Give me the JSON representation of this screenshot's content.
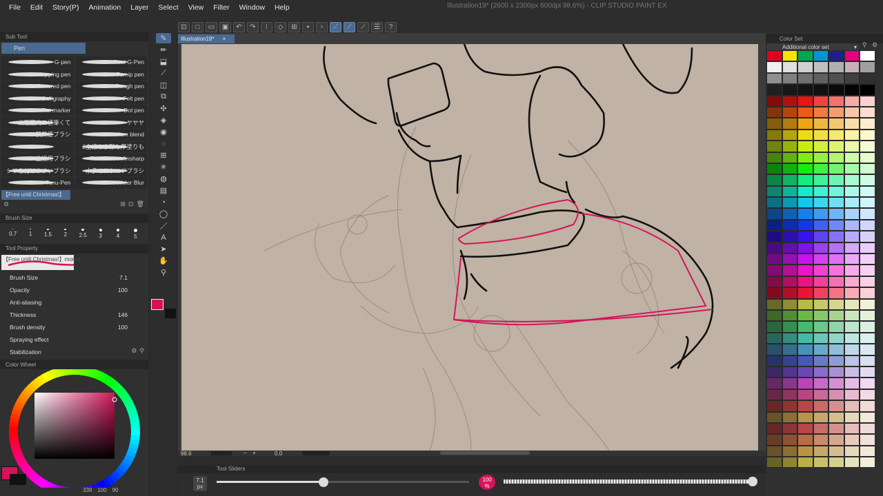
{
  "menu": [
    "File",
    "Edit",
    "Story(P)",
    "Animation",
    "Layer",
    "Select",
    "View",
    "Filter",
    "Window",
    "Help"
  ],
  "window_title": "Illustration19* (2600 x 2300px 600dpi 98.6%) - CLIP STUDIO PAINT EX",
  "subtool": {
    "header": "Sub Tool",
    "group": "Pen",
    "brushes": [
      {
        "left": "G-pen",
        "right": "Real G-Pen"
      },
      {
        "left": "Mapping pen",
        "right": "Turnip pen"
      },
      {
        "left": "Textured pen",
        "right": "Rough pen"
      },
      {
        "left": "Calligraphy",
        "right": "Felt pen"
      },
      {
        "left": "Flat marker",
        "right": "Dot pen"
      },
      {
        "left": "山猫筋肉二値筆くて",
        "right": "ヤヤヤ"
      },
      {
        "left": "肌質感ブラシ",
        "right": "Medium blend"
      },
      {
        "left": "",
        "right": "2主線も水彩も厚塗りも"
      },
      {
        "left": "主線用ブラシ",
        "right": "Tanu-Pen softnsharp"
      },
      {
        "left": "シワを付けやすいブラシ",
        "right": "水多めスケエアブラシ"
      },
      {
        "left": "Tanu-Pen",
        "right": "Water Blur"
      }
    ],
    "selected": "【Free until Christmas!】"
  },
  "brush_size_panel": {
    "header": "Brush Size",
    "sizes": [
      "0.7",
      "1",
      "1.5",
      "2",
      "2.5",
      "3",
      "4",
      "5"
    ]
  },
  "tool_property": {
    "header": "Tool Property",
    "preset": "【Free until Christmas!】morna",
    "rows": [
      {
        "label": "Brush Size",
        "value": "7.1"
      },
      {
        "label": "Opacity",
        "value": "100"
      },
      {
        "label": "Anti-aliasing",
        "value": ""
      },
      {
        "label": "Thickness",
        "value": "146"
      },
      {
        "label": "Brush density",
        "value": "100"
      },
      {
        "label": "Spraying effect",
        "value": ""
      },
      {
        "label": "Stabilization",
        "value": ""
      }
    ]
  },
  "color_wheel": {
    "header": "Color Wheel",
    "main_color": "#d4145a",
    "values": [
      "339",
      "100",
      "90"
    ]
  },
  "document_tab": "Illustration19*",
  "navigator": {
    "zoom": "98.6",
    "angle": "0.0"
  },
  "tool_sliders": {
    "header": "Tool Sliders",
    "size_value": "7.1",
    "size_unit": "px",
    "opacity_value": "100",
    "opacity_unit": "%"
  },
  "color_set": {
    "header": "Color Set",
    "set_name": "Additional color set"
  }
}
